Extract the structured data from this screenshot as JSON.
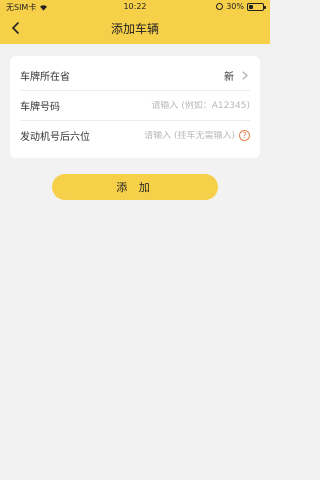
{
  "status_bar": {
    "carrier": "无SIM卡",
    "time": "10:22",
    "battery": "30%",
    "battery_level": 0.3
  },
  "nav": {
    "title": "添加车辆"
  },
  "form": {
    "province": {
      "label": "车牌所在省",
      "value": "新"
    },
    "plate": {
      "label": "车牌号码",
      "placeholder": "请输入 (例如：A12345)"
    },
    "engine": {
      "label": "发动机号后六位",
      "placeholder": "请输入 (挂车无需输入)",
      "help": "?"
    }
  },
  "submit_label": "添 加",
  "colors": {
    "accent": "#f7d04a",
    "help": "#e4834a"
  },
  "icons": {
    "back": "chevron-left-icon",
    "province_chevron": "chevron-right-icon",
    "engine_help": "question-circle-icon"
  }
}
